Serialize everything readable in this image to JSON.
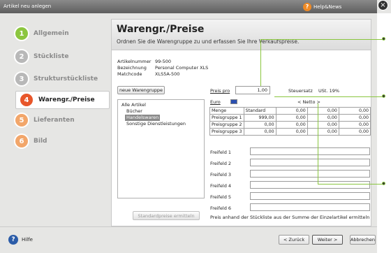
{
  "window": {
    "title": "Artikel neu anlegen",
    "help_label": "Help&News",
    "close_glyph": "×"
  },
  "sidebar": {
    "items": [
      {
        "num": "1",
        "label": "Allgemein",
        "color": "#8cc63f",
        "active": false
      },
      {
        "num": "2",
        "label": "Stückliste",
        "color": "#b8b8b8",
        "active": false
      },
      {
        "num": "3",
        "label": "Strukturstückliste",
        "color": "#b8b8b8",
        "active": false
      },
      {
        "num": "4",
        "label": "Warengr./Preise",
        "color": "#e8562a",
        "active": true
      },
      {
        "num": "5",
        "label": "Lieferanten",
        "color": "#f2a66a",
        "active": false
      },
      {
        "num": "6",
        "label": "Bild",
        "color": "#f2a66a",
        "active": false
      }
    ]
  },
  "header": {
    "title": "Warengr./Preise",
    "subtitle": "Ordnen Sie die Warengruppe zu und erfassen Sie Ihre Verkaufspreise."
  },
  "article": {
    "nr_label": "Artikelnummer",
    "nr_value": "99-500",
    "bez_label": "Bezeichnung",
    "bez_value": "Personal Computer XLS",
    "mc_label": "Matchcode",
    "mc_value": "XLS5A-500"
  },
  "buttons": {
    "new_group": "neue Warengruppe",
    "standard_prices": "Standardpreise ermitteln",
    "back": "< Zurück",
    "next": "Weiter >",
    "cancel": "Abbrechen",
    "help": "Hilfe"
  },
  "tree": {
    "items": [
      {
        "label": "Alle Artikel",
        "indent": 0,
        "selected": false
      },
      {
        "label": "Bücher",
        "indent": 1,
        "selected": false
      },
      {
        "label": "Handelswaren",
        "indent": 1,
        "selected": true
      },
      {
        "label": "Sonstige Dienstleistungen",
        "indent": 1,
        "selected": false
      }
    ]
  },
  "prices": {
    "preis_pro_label": "Preis pro",
    "preis_pro_value": "1,00",
    "steuer_label": "Steuersatz",
    "steuer_value": "USt. 19%",
    "currency_label": "Euro",
    "netto_label": "< Netto >",
    "header": [
      "Menge",
      "Standard",
      "0,00",
      "0,00",
      "0,00"
    ],
    "rows": [
      [
        "Preisgruppe 1",
        "999,00",
        "0,00",
        "0,00",
        "0,00"
      ],
      [
        "Preisgruppe 2",
        "0,00",
        "0,00",
        "0,00",
        "0,00"
      ],
      [
        "Preisgruppe 3",
        "0,00",
        "0,00",
        "0,00",
        "0,00"
      ]
    ]
  },
  "freefields": [
    "Freifeld 1",
    "Freifeld 2",
    "Freifeld 3",
    "Freifeld 4",
    "Freifeld 5",
    "Freifeld 6"
  ],
  "footnote": "Preis anhand der Stückliste aus der Summe der Einzelartikel ermitteln"
}
